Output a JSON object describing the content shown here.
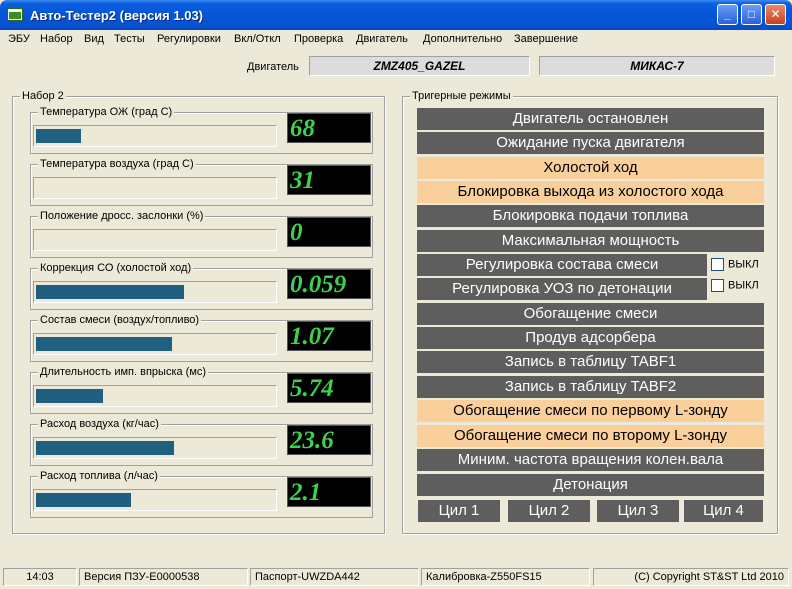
{
  "window": {
    "title": "Авто-Тестер2  (версия 1.03)",
    "min_label": "_",
    "max_label": "□",
    "close_label": "✕"
  },
  "menu": [
    "ЭБУ",
    "Набор",
    "Вид",
    "Тесты",
    "Регулировки",
    "Вкл/Откл",
    "Проверка",
    "Двигатель",
    "Дополнительно",
    "Завершение"
  ],
  "engine": {
    "label": "Двигатель",
    "model": "ZMZ405_GAZEL",
    "ecu": "МИКАС-7"
  },
  "params_panel": {
    "title": "Набор 2",
    "params": [
      {
        "label": "Температура  ОЖ (град С)",
        "value": "68",
        "fill": 0.19
      },
      {
        "label": "Температура  воздуха (град С)",
        "value": "31",
        "fill": 0
      },
      {
        "label": "Положение дросс. заслонки (%)",
        "value": "0",
        "fill": 0
      },
      {
        "label": "Коррекция СО (холостой ход)",
        "value": "0.059",
        "fill": 0.62
      },
      {
        "label": "Состав смеси (воздух/топливо)",
        "value": "1.07",
        "fill": 0.57
      },
      {
        "label": "Длительность имп. впрыска (мс)",
        "value": "5.74",
        "fill": 0.28
      },
      {
        "label": "Расход воздуха (кг/час)",
        "value": "23.6",
        "fill": 0.58
      },
      {
        "label": "Расход топлива (л/час)",
        "value": "2.1",
        "fill": 0.4
      }
    ]
  },
  "triggers_panel": {
    "title": "Тригерные режимы",
    "modes": [
      {
        "label": "Двигатель остановлен",
        "active": false
      },
      {
        "label": "Ожидание пуска двигателя",
        "active": false
      },
      {
        "label": "Холостой ход",
        "active": true
      },
      {
        "label": "Блокировка выхода из холостого хода",
        "active": true
      },
      {
        "label": "Блокировка подачи топлива",
        "active": false
      },
      {
        "label": "Максимальная мощность",
        "active": false
      },
      {
        "label": "Регулировка состава смеси",
        "active": false
      },
      {
        "label": "Регулировка УОЗ по детонации",
        "active": false
      },
      {
        "label": "Обогащение смеси",
        "active": false
      },
      {
        "label": "Продув адсорбера",
        "active": false
      },
      {
        "label": "Запись в таблицу TABF1",
        "active": false
      },
      {
        "label": "Запись в таблицу TABF2",
        "active": false
      },
      {
        "label": "Обогащение смеси по первому L-зонду",
        "active": true
      },
      {
        "label": "Обогащение смеси по второму L-зонду",
        "active": true
      },
      {
        "label": "Миним. частота вращения колен.вала",
        "active": false
      },
      {
        "label": "Детонация",
        "active": false
      }
    ],
    "checkboxes": [
      {
        "label": "ВЫКЛ",
        "checked": false
      },
      {
        "label": "ВЫКЛ",
        "checked": false
      }
    ],
    "cylinders": [
      "Цил 1",
      "Цил 2",
      "Цил 3",
      "Цил 4"
    ]
  },
  "status": {
    "time": "14:03",
    "rom_version": "Версия ПЗУ-E0000538",
    "passport": "Паспорт-UWZDA442",
    "calibration": "Калибровка-Z550FS15",
    "copyright": "(C) Copyright ST&ST Ltd 2010"
  },
  "colors": {
    "bar_fill": "#1f6080",
    "lcd_text": "#3cd24a",
    "mode_inactive": "#5e5e5e",
    "mode_active": "#f9cf9c"
  }
}
